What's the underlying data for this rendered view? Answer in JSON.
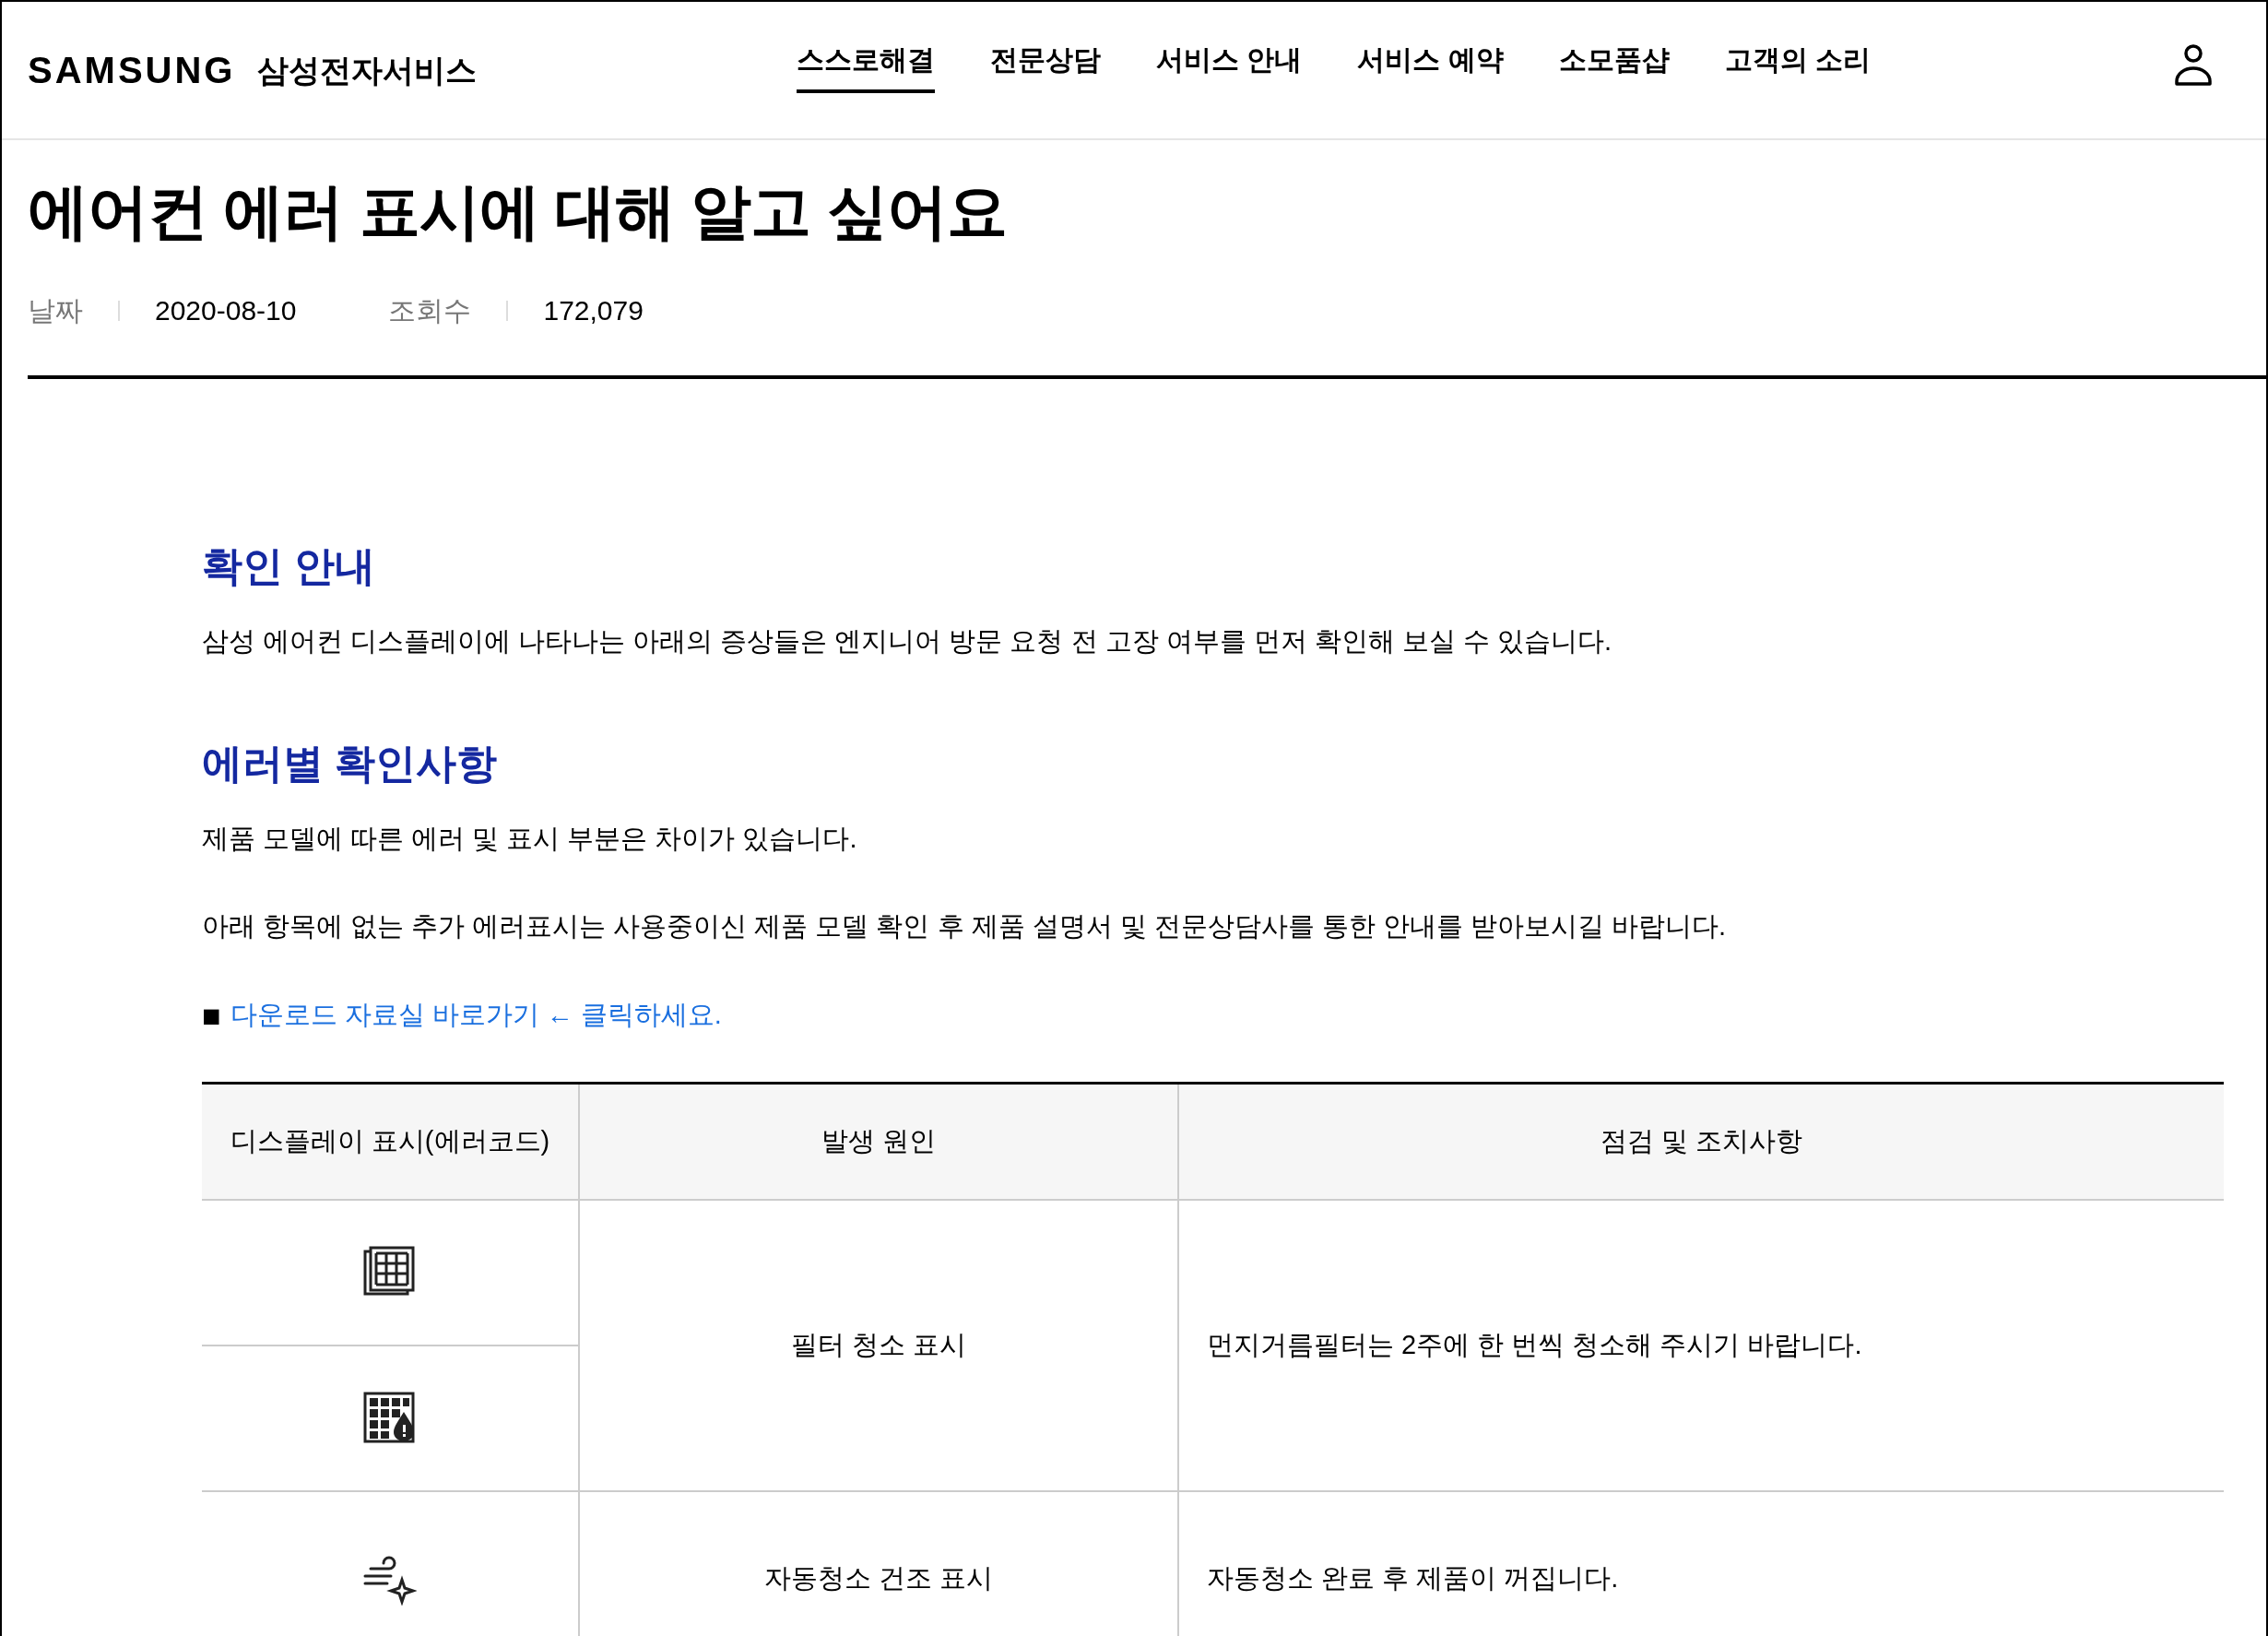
{
  "header": {
    "logo": "SAMSUNG",
    "service_name": "삼성전자서비스",
    "nav": [
      {
        "label": "스스로해결",
        "selected": true
      },
      {
        "label": "전문상담",
        "selected": false
      },
      {
        "label": "서비스 안내",
        "selected": false
      },
      {
        "label": "서비스 예약",
        "selected": false
      },
      {
        "label": "소모품샵",
        "selected": false
      },
      {
        "label": "고객의 소리",
        "selected": false
      }
    ]
  },
  "article": {
    "title": "에어컨 에러 표시에 대해 알고 싶어요",
    "meta": [
      {
        "label": "날짜",
        "value": "2020-08-10"
      },
      {
        "label": "조회수",
        "value": "172,079"
      }
    ]
  },
  "content": [
    {
      "kind": "heading",
      "text": "확인 안내"
    },
    {
      "kind": "paragraph",
      "text": "삼성 에어컨 디스플레이에 나타나는 아래의 증상들은 엔지니어 방문 요청 전 고장 여부를 먼저 확인해 보실 수 있습니다."
    },
    {
      "kind": "heading",
      "text": "에러별 확인사항"
    },
    {
      "kind": "paragraph",
      "text": "제품 모델에 따른 에러 및 표시 부분은 차이가 있습니다."
    },
    {
      "kind": "paragraph",
      "text": "아래 항목에 없는 추가 에러표시는 사용중이신 제품 모델 확인 후 제품 설명서 및 전문상담사를 통한 안내를 받아보시길 바랍니다."
    },
    {
      "kind": "link",
      "bullet": "■",
      "text": "다운로드 자료실 바로가기 ← 클릭하세요."
    }
  ],
  "table": {
    "columns": [
      "디스플레이 표시(에러코드)",
      "발생 원인",
      "점검 및 조치사항"
    ],
    "rows": [
      {
        "displays": [
          {
            "kind": "filter"
          },
          {
            "kind": "filter-alert"
          }
        ],
        "cause": "필터 청소 표시",
        "action": "먼지거름필터는 2주에 한 번씩 청소해 주시기 바랍니다."
      },
      {
        "displays": [
          {
            "kind": "wind-sparkle"
          }
        ],
        "cause": "자동청소 건조 표시",
        "action": "자동청소 완료 후 제품이 꺼집니다."
      }
    ]
  }
}
